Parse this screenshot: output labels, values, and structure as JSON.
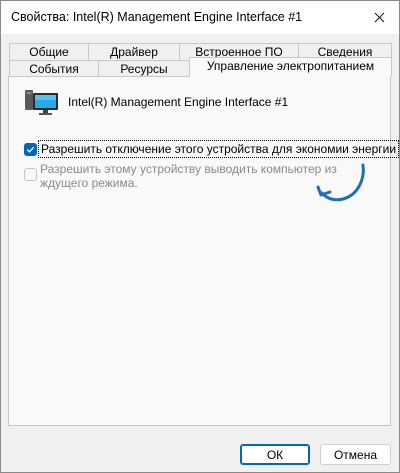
{
  "window": {
    "title": "Свойства: Intel(R) Management Engine Interface #1"
  },
  "tabs": {
    "row1": [
      "Общие",
      "Драйвер",
      "Встроенное ПО",
      "Сведения"
    ],
    "row2": [
      "События",
      "Ресурсы",
      "Управление электропитанием"
    ],
    "active": "Управление электропитанием"
  },
  "device": {
    "icon": "computer-monitor-icon",
    "name": "Intel(R) Management Engine Interface #1"
  },
  "options": {
    "allow_turn_off": {
      "label": "Разрешить отключение этого устройства для экономии энергии",
      "checked": true,
      "enabled": true
    },
    "allow_wake": {
      "label": "Разрешить этому устройству выводить компьютер из ждущего режима.",
      "checked": false,
      "enabled": false
    }
  },
  "buttons": {
    "ok": "ОК",
    "cancel": "Отмена"
  },
  "colors": {
    "accent": "#0067c0",
    "annotation_arrow": "#1f6fb8"
  }
}
